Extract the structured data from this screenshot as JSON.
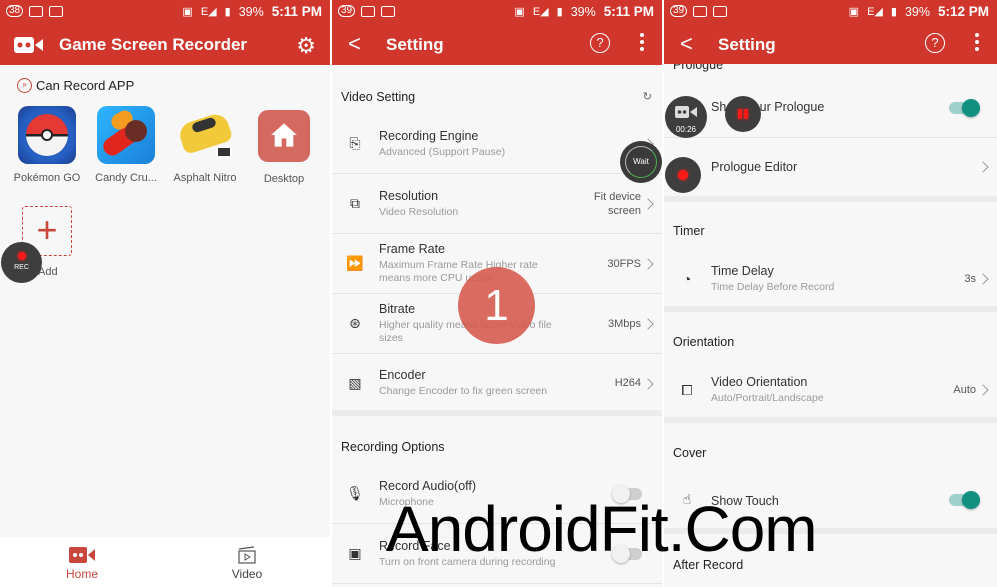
{
  "colors": {
    "brand": "#d0362c",
    "accent_toggle": "#11907f",
    "text": "#333333",
    "subtext": "#9a9a9a"
  },
  "watermark": "AndroidFit.Com",
  "panel1": {
    "status": {
      "badge": "38",
      "battery": "39%",
      "time": "5:11 PM",
      "network": "E"
    },
    "appbar": {
      "title": "Game Screen Recorder",
      "logo_icon": "gamepad-camera-icon",
      "settings_icon": "gear-icon"
    },
    "section_title": "Can Record APP",
    "apps": [
      {
        "label": "Pokémon GO",
        "icon": "pokemon-go-icon"
      },
      {
        "label": "Candy Cru...",
        "icon": "candy-crush-icon"
      },
      {
        "label": "Asphalt Nitro",
        "icon": "asphalt-nitro-icon"
      },
      {
        "label": "Desktop",
        "icon": "home-icon"
      }
    ],
    "add_label": "Add",
    "add_symbol": "+",
    "rec_float_label": "REC",
    "bottom_tabs": [
      {
        "label": "Home",
        "icon": "gamepad-camera-icon",
        "active": true
      },
      {
        "label": "Video",
        "icon": "clapperboard-icon",
        "active": false
      }
    ]
  },
  "panel2": {
    "status": {
      "badge": "39",
      "battery": "39%",
      "time": "5:11 PM",
      "network": "E"
    },
    "appbar": {
      "title": "Setting",
      "back": "<",
      "help": "?"
    },
    "video_setting": {
      "title": "Video Setting",
      "rows": [
        {
          "title": "Recording Engine",
          "subtitle": "Advanced (Support Pause)",
          "value": "",
          "icon": "cast-icon"
        },
        {
          "title": "Resolution",
          "subtitle": "Video Resolution",
          "value": "Fit device screen",
          "icon": "resolution-icon"
        },
        {
          "title": "Frame Rate",
          "subtitle": "Maximum Frame Rate Higher rate means more CPU usage",
          "value": "30FPS",
          "icon": "fast-forward-icon"
        },
        {
          "title": "Bitrate",
          "subtitle": "Higher quality means larger video file sizes",
          "value": "3Mbps",
          "icon": "film-reel-icon"
        },
        {
          "title": "Encoder",
          "subtitle": "Change Encoder to fix green screen",
          "value": "H264",
          "icon": "video-file-icon"
        }
      ]
    },
    "recording_options": {
      "title": "Recording Options",
      "rows": [
        {
          "title": "Record Audio(off)",
          "subtitle": "Microphone",
          "toggle": false,
          "icon": "microphone-icon"
        },
        {
          "title": "Record Face",
          "subtitle": "Turn on front camera during recording",
          "toggle": false,
          "icon": "front-camera-icon"
        }
      ]
    },
    "step_badge": "1",
    "wait_label": "Wait"
  },
  "panel3": {
    "status": {
      "badge": "39",
      "battery": "39%",
      "time": "5:12 PM",
      "network": "E"
    },
    "appbar": {
      "title": "Setting",
      "back": "<",
      "help": "?"
    },
    "prologue": {
      "title": "Prologue",
      "rows": [
        {
          "title": "Show Your Prologue",
          "toggle": true
        },
        {
          "title": "Prologue Editor"
        }
      ]
    },
    "timer": {
      "title": "Timer",
      "row": {
        "title": "Time Delay",
        "subtitle": "Time Delay Before Record",
        "value": "3s",
        "icon": "speedometer-icon"
      }
    },
    "orientation": {
      "title": "Orientation",
      "row": {
        "title": "Video Orientation",
        "subtitle": "Auto/Portrait/Landscape",
        "value": "Auto",
        "icon": "orientation-icon"
      }
    },
    "cover": {
      "title": "Cover",
      "row": {
        "title": "Show Touch",
        "toggle": true,
        "icon": "touch-hand-icon"
      }
    },
    "after_record": {
      "title": "After Record"
    },
    "float_timer": "00:26"
  }
}
